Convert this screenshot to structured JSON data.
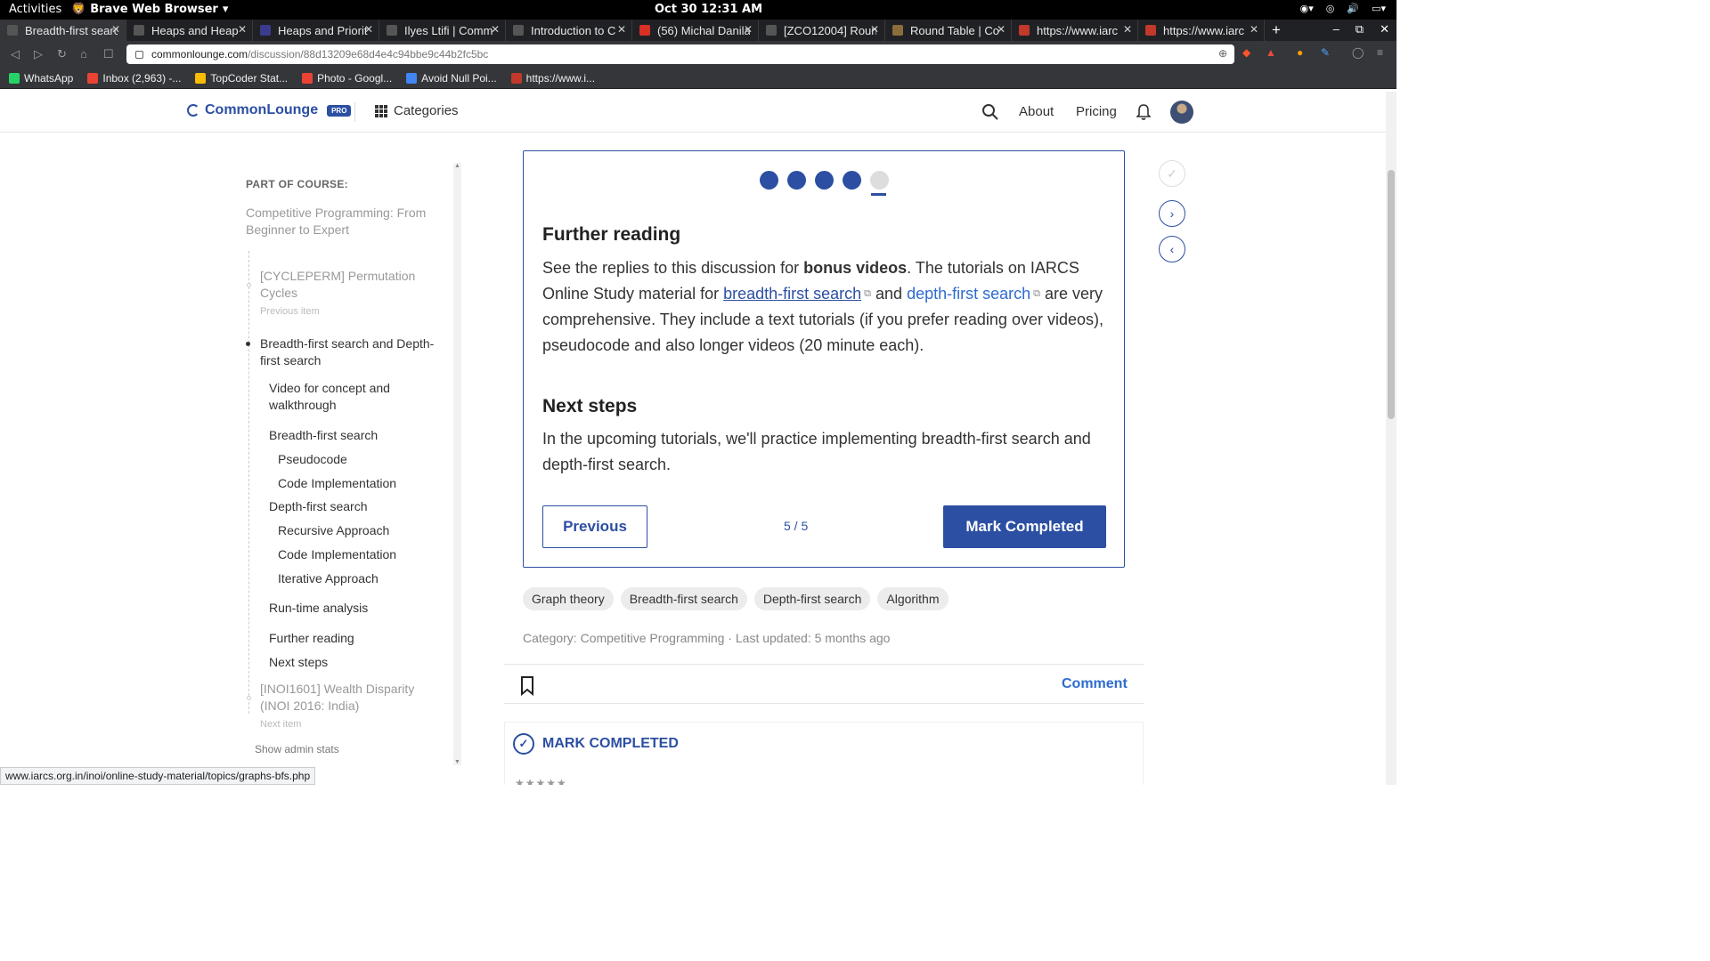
{
  "system": {
    "activities": "Activities",
    "app_name": "Brave Web Browser",
    "clock": "Oct 30  12:31 AM"
  },
  "tabs": [
    {
      "title": "Breadth-first search",
      "color": "#555555"
    },
    {
      "title": "Heaps and Heap",
      "color": "#555555"
    },
    {
      "title": "Heaps and Priorit",
      "color": "#3b3b8f"
    },
    {
      "title": "Ilyes Ltifi | Comm",
      "color": "#555555"
    },
    {
      "title": "Introduction to C",
      "color": "#555555"
    },
    {
      "title": "(56) Michal Danila",
      "color": "#d93025"
    },
    {
      "title": "[ZCO12004] Roun",
      "color": "#555555"
    },
    {
      "title": "Round Table | Co",
      "color": "#8a6d3b"
    },
    {
      "title": "https://www.iarc",
      "color": "#c0392b"
    },
    {
      "title": "https://www.iarc",
      "color": "#c0392b"
    }
  ],
  "address": {
    "host": "commonlounge.com",
    "path": "/discussion/88d13209e68d4e4c94bbe9c44b2fc5bc"
  },
  "bookmarks": [
    {
      "label": "WhatsApp",
      "color": "#25d366"
    },
    {
      "label": "Inbox (2,963) -...",
      "color": "#ea4335"
    },
    {
      "label": "TopCoder Stat...",
      "color": "#fbbc05"
    },
    {
      "label": "Photo - Googl...",
      "color": "#ea4335"
    },
    {
      "label": "Avoid Null Poi...",
      "color": "#4285f4"
    },
    {
      "label": "https://www.i...",
      "color": "#c0392b"
    }
  ],
  "header": {
    "brand": "CommonLounge",
    "pro_badge": "PRO",
    "categories": "Categories",
    "about": "About",
    "pricing": "Pricing"
  },
  "sidebar": {
    "part_of": "PART OF COURSE:",
    "course_title": "Competitive Programming: From Beginner to Expert",
    "previous": {
      "title": "[CYCLEPERM] Permutation Cycles",
      "sub": "Previous item"
    },
    "current": "Breadth-first search and Depth-first search",
    "items": [
      "Video for concept and walkthrough",
      "Breadth-first search",
      "Pseudocode",
      "Code Implementation",
      "Depth-first search",
      "Recursive Approach",
      "Code Implementation",
      "Iterative Approach",
      "Run-time analysis",
      "Further reading",
      "Next steps"
    ],
    "next": {
      "title": "[INOI1601] Wealth Disparity (INOI 2016: India)",
      "sub": "Next item"
    },
    "admin_stats": "Show admin stats"
  },
  "card": {
    "progress": {
      "current": 5,
      "total": 5
    },
    "further_heading": "Further reading",
    "p1_a": "See the replies to this discussion for ",
    "p1_bold": "bonus videos",
    "p1_b": ". The tutorials on IARCS Online Study material for ",
    "link_bfs": "breadth-first search",
    "p1_c": " and ",
    "link_dfs": "depth-first search",
    "p1_d": " are very comprehensive. They include a text tutorials (if you prefer reading over videos), pseudocode and also longer videos (20 minute each).",
    "next_heading": "Next steps",
    "p2": "In the upcoming tutorials, we'll practice implementing breadth-first search and depth-first search.",
    "previous_button": "Previous",
    "counter": "5 / 5",
    "mark_button": "Mark Completed"
  },
  "tags": [
    "Graph theory",
    "Breadth-first search",
    "Depth-first search",
    "Algorithm"
  ],
  "meta": {
    "category": "Category: Competitive Programming",
    "updated": "Last updated: 5 months ago"
  },
  "actions": {
    "comment": "Comment",
    "mark_completed": "MARK COMPLETED"
  },
  "status_url": "www.iarcs.org.in/inoi/online-study-material/topics/graphs-bfs.php",
  "colors": {
    "accent": "#2c4fa3",
    "link": "#2e6bd0"
  }
}
